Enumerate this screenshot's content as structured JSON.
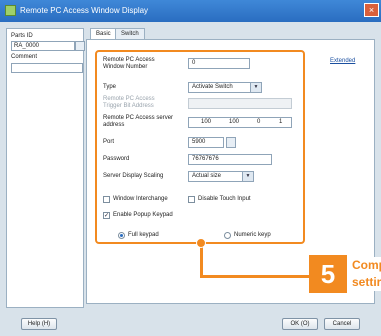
{
  "window": {
    "title": "Remote PC Access Window Display",
    "close_glyph": "×"
  },
  "left_panel": {
    "parts_id_label": "Parts ID",
    "parts_id_value": "RA_0000",
    "comment_label": "Comment",
    "comment_value": ""
  },
  "tabs": [
    {
      "label": "Basic",
      "active": true
    },
    {
      "label": "Switch",
      "active": false
    }
  ],
  "form": {
    "window_number_label": "Remote PC Access Window Number",
    "window_number_value": "0",
    "type_label": "Type",
    "type_value": "Activate Switch",
    "trigger_label": "Remote PC Access Trigger Bit Address",
    "trigger_value": "",
    "server_address_label": "Remote PC Access server address",
    "server_address_octets": [
      "100",
      "100",
      "0",
      "1"
    ],
    "port_label": "Port",
    "port_value": "5900",
    "password_label": "Password",
    "password_value": "76767676",
    "scaling_label": "Server Display Scaling",
    "scaling_value": "Actual size",
    "window_interchange_label": "Window Interchange",
    "window_interchange_checked": false,
    "disable_touch_label": "Disable Touch Input",
    "disable_touch_checked": false,
    "enable_popup_label": "Enable Popup Keypad",
    "enable_popup_checked": true,
    "full_keypad_label": "Full keypad",
    "numeric_keypad_label": "Numeric keyp",
    "keypad_selected": "full",
    "extended_link_label": "Extended"
  },
  "callout": {
    "number": "5",
    "text_line1": "Comp",
    "text_line2": "settir",
    "color": "#f28a20"
  },
  "buttons": {
    "help": "Help (H)",
    "ok": "OK (O)",
    "cancel": "Cancel"
  }
}
